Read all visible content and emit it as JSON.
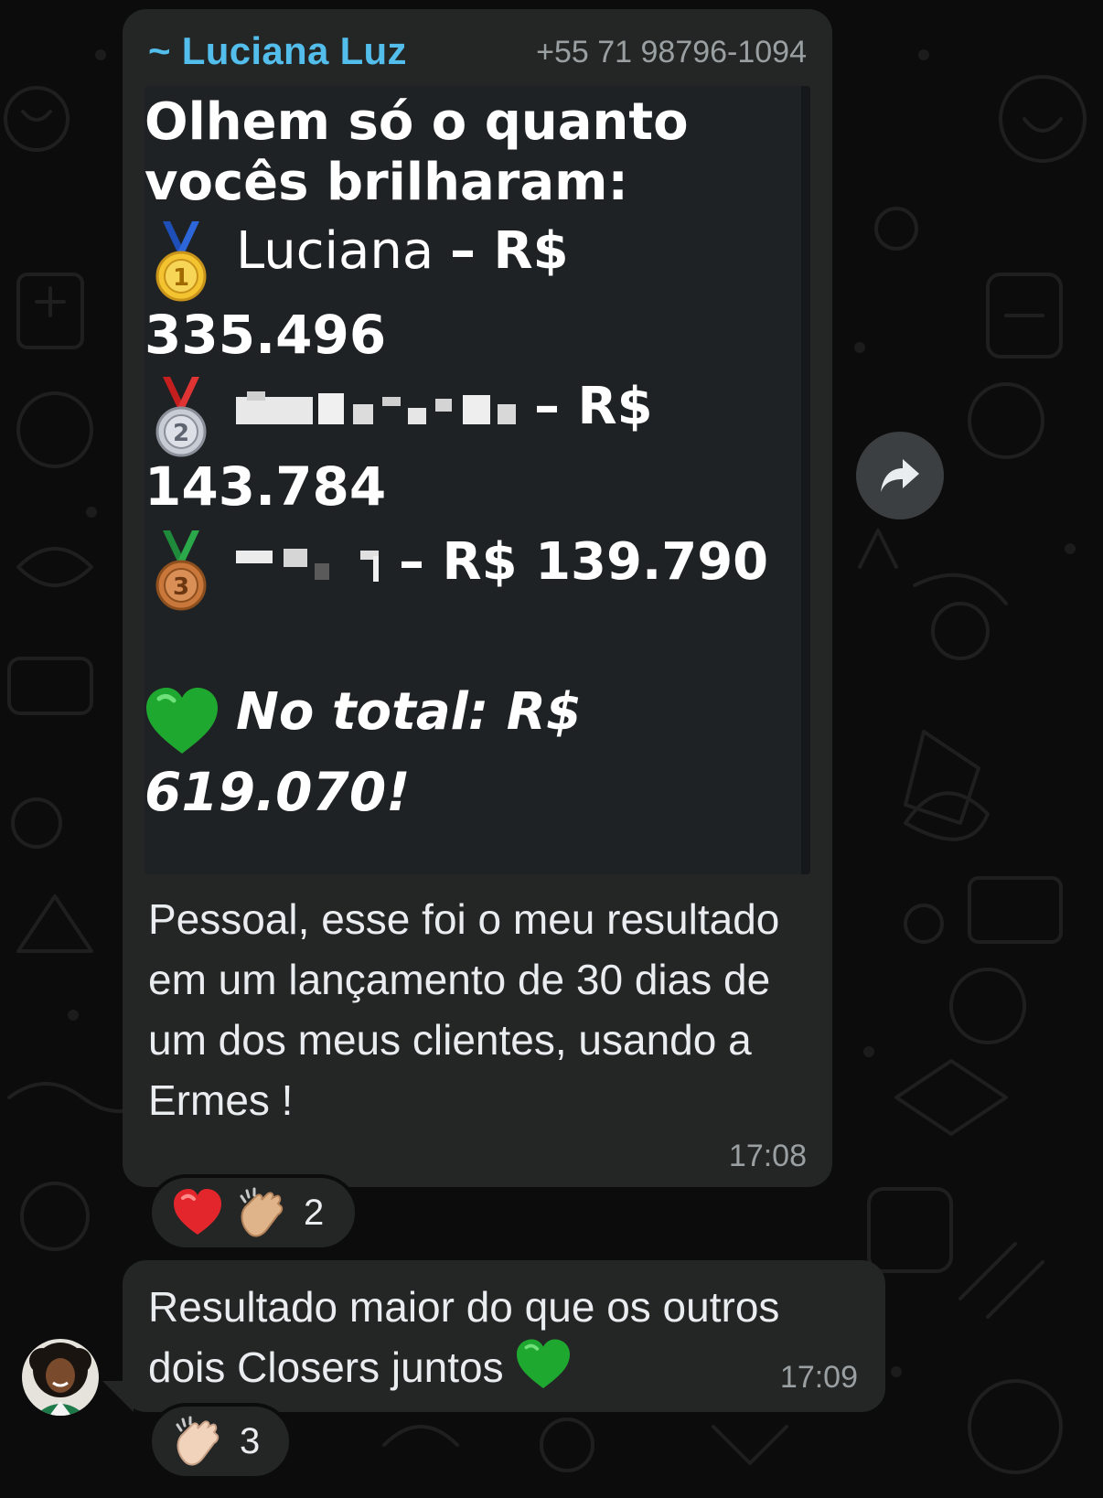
{
  "message_1": {
    "sender_name": "~ Luciana Luz",
    "sender_phone": "+55 71 98796-1094",
    "card": {
      "title_line_1": "Olhem só o quanto",
      "title_line_2": "vocês brilharam:",
      "rank_1_name": "Luciana",
      "rank_1_currency": "– R$",
      "rank_1_amount": "335.496",
      "rank_2_currency": "– R$",
      "rank_2_amount": "143.784",
      "rank_3_amount_inline": "– R$ 139.790",
      "total_label": "No total: R$",
      "total_amount": "619.070!"
    },
    "caption": "Pessoal, esse foi o meu resultado em um lançamento de 30 dias de um dos meus clientes, usando a Ermes !",
    "time": "17:08",
    "reactions": {
      "emojis": [
        "red-heart",
        "clapping-hands"
      ],
      "count": "2"
    }
  },
  "message_2": {
    "text": "Resultado maior do que os outros dois Closers juntos",
    "emoji": "green-heart",
    "time": "17:09",
    "reactions": {
      "emojis": [
        "clapping-hands"
      ],
      "count": "3"
    }
  },
  "colors": {
    "background": "#0c0c0c",
    "bubble": "#242626",
    "sender_name": "#53bdeb",
    "meta_text": "#9aa0a2",
    "message_text": "#e9edef"
  },
  "icons": {
    "forward": "forward-arrow-icon",
    "gold_medal": "first-place-medal-icon",
    "silver_medal": "second-place-medal-icon",
    "bronze_medal": "third-place-medal-icon"
  }
}
